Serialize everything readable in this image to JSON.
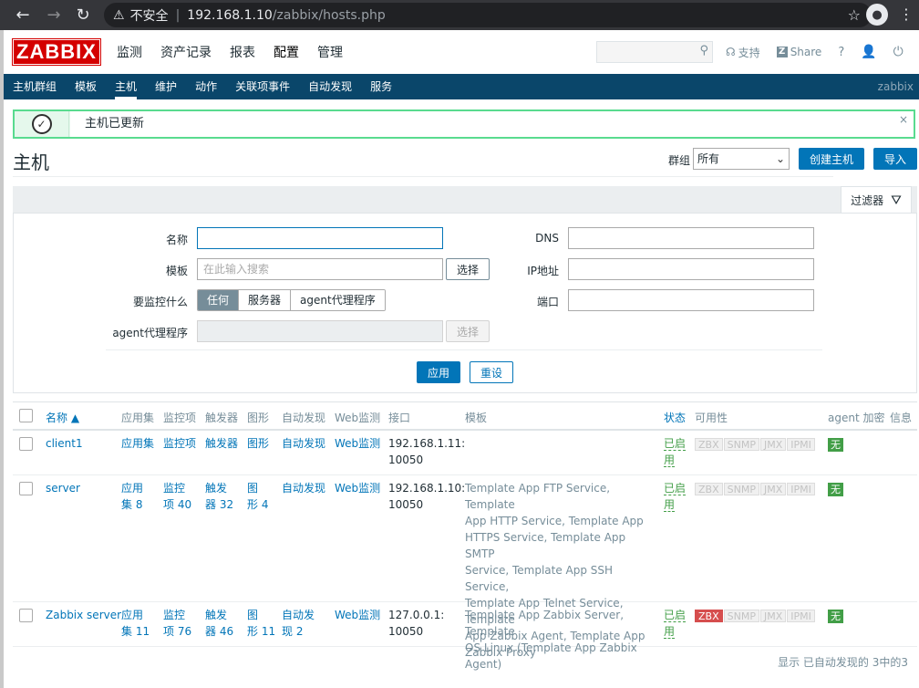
{
  "browser": {
    "insecure_label": "不安全",
    "url_host": "192.168.1.10",
    "url_path": "/zabbix/hosts.php"
  },
  "header": {
    "logo": "ZABBIX",
    "menu": [
      "监测",
      "资产记录",
      "报表",
      "配置",
      "管理"
    ],
    "search_placeholder": "",
    "support": "支持",
    "share": "Share",
    "help": "?"
  },
  "subnav": {
    "items": [
      "主机群组",
      "模板",
      "主机",
      "维护",
      "动作",
      "关联项事件",
      "自动发现",
      "服务"
    ],
    "brand": "zabbix"
  },
  "message": {
    "text": "主机已更新",
    "close": "×"
  },
  "page": {
    "title": "主机",
    "group_label": "群组",
    "group_value": "所有",
    "create_button": "创建主机",
    "import_button": "导入"
  },
  "filter": {
    "tab_label": "过滤器",
    "name_label": "名称",
    "name_value": "",
    "templates_label": "模板",
    "templates_placeholder": "在此输入搜索",
    "select_label": "选择",
    "monitored_by_label": "要监控什么",
    "monitored_by_options": [
      "任何",
      "服务器",
      "agent代理程序"
    ],
    "proxy_label": "agent代理程序",
    "proxy_select_label": "选择",
    "dns_label": "DNS",
    "ip_label": "IP地址",
    "port_label": "端口",
    "apply": "应用",
    "reset": "重设"
  },
  "table": {
    "headers": [
      "名称 ▲",
      "应用集",
      "监控项",
      "触发器",
      "图形",
      "自动发现",
      "Web监测",
      "接口",
      "模板",
      "状态",
      "可用性",
      "agent 加密",
      "信息"
    ],
    "rows": [
      {
        "name": "client1",
        "applications": "应用集",
        "items": "监控项",
        "triggers": "触发器",
        "graphs": "图形",
        "discovery": "自动发现",
        "web": "Web监测",
        "interface_1": "192.168.1.11:",
        "interface_2": "10050",
        "templates": "",
        "status_1": "已启",
        "status_2": "用",
        "encryption": "无"
      },
      {
        "name": "server",
        "applications_1": "应用",
        "applications_2": "集 8",
        "items_1": "监控",
        "items_2": "项 40",
        "triggers_1": "触发",
        "triggers_2": "器 32",
        "graphs_1": "图",
        "graphs_2": "形 4",
        "discovery": "自动发现",
        "web": "Web监测",
        "interface_1": "192.168.1.10:",
        "interface_2": "10050",
        "template_lines": [
          "Template App FTP Service, Template",
          "App HTTP Service, Template App",
          "HTTPS Service, Template App SMTP",
          "Service, Template App SSH Service,",
          "Template App Telnet Service, Template",
          "App Zabbix Agent, Template App",
          "Zabbix Proxy"
        ],
        "status_1": "已启",
        "status_2": "用",
        "encryption": "无"
      },
      {
        "name": "Zabbix server",
        "applications_1": "应用",
        "applications_2": "集 11",
        "items_1": "监控",
        "items_2": "项 76",
        "triggers_1": "触发",
        "triggers_2": "器 46",
        "graphs_1": "图",
        "graphs_2": "形 11",
        "discovery_1": "自动发",
        "discovery_2": "现 2",
        "web": "Web监测",
        "interface_1": "127.0.0.1:",
        "interface_2": "10050",
        "template_lines": [
          "Template App Zabbix Server, Template",
          "OS Linux (Template App Zabbix Agent)"
        ],
        "status_1": "已启",
        "status_2": "用",
        "encryption": "无"
      }
    ],
    "availability": [
      "ZBX",
      "SNMP",
      "JMX",
      "IPMI"
    ],
    "footer": "显示 已自动发现的 3中的3"
  },
  "colors": {
    "primary": "#0275b8",
    "subnav": "#0a466a",
    "logo": "#d40000",
    "success": "#429e47",
    "unavailable": "#d64e4e"
  }
}
